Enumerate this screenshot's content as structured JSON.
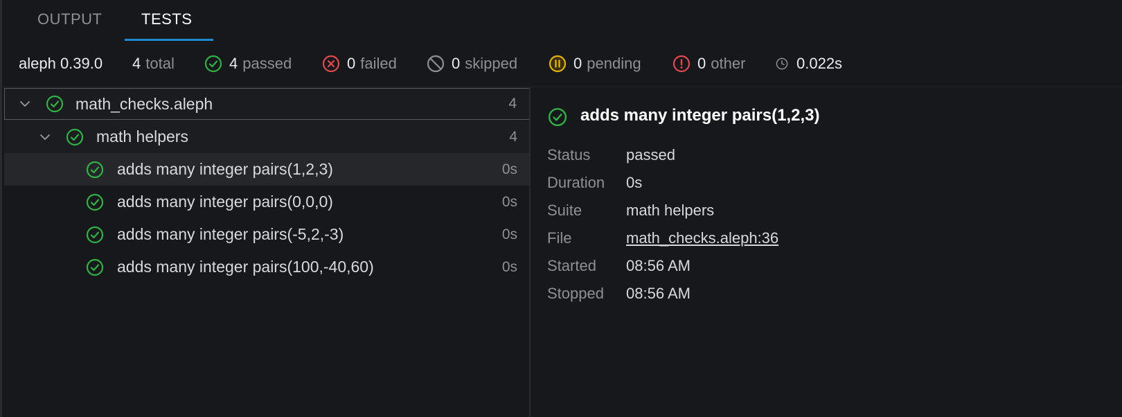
{
  "tabs": [
    {
      "label": "OUTPUT",
      "active": false
    },
    {
      "label": "TESTS",
      "active": true
    }
  ],
  "summary": {
    "runner": "aleph 0.39.0",
    "total": {
      "num": "4",
      "label": "total"
    },
    "passed": {
      "num": "4",
      "label": "passed",
      "icon": "check-circle-icon",
      "color": "#2fb344"
    },
    "failed": {
      "num": "0",
      "label": "failed",
      "icon": "x-circle-icon",
      "color": "#e5484d"
    },
    "skipped": {
      "num": "0",
      "label": "skipped",
      "icon": "skip-icon",
      "color": "#8e9096"
    },
    "pending": {
      "num": "0",
      "label": "pending",
      "icon": "pause-circle-icon",
      "color": "#e5b400"
    },
    "other": {
      "num": "0",
      "label": "other",
      "icon": "exclamation-circle-icon",
      "color": "#e5484d"
    },
    "duration": {
      "num": "0.022s",
      "icon": "clock-icon"
    }
  },
  "tree": {
    "file": {
      "label": "math_checks.aleph",
      "count": "4",
      "status": "passed"
    },
    "suite": {
      "label": "math helpers",
      "count": "4",
      "status": "passed"
    },
    "tests": [
      {
        "label": "adds many integer pairs(1,2,3)",
        "time": "0s",
        "selected": true
      },
      {
        "label": "adds many integer pairs(0,0,0)",
        "time": "0s",
        "selected": false
      },
      {
        "label": "adds many integer pairs(-5,2,-3)",
        "time": "0s",
        "selected": false
      },
      {
        "label": "adds many integer pairs(100,-40,60)",
        "time": "0s",
        "selected": false
      }
    ]
  },
  "detail": {
    "title": "adds many integer pairs(1,2,3)",
    "fields": [
      {
        "key": "Status",
        "value": "passed"
      },
      {
        "key": "Duration",
        "value": "0s"
      },
      {
        "key": "Suite",
        "value": "math helpers"
      },
      {
        "key": "File",
        "value": "math_checks.aleph:36",
        "link": true
      },
      {
        "key": "Started",
        "value": "08:56 AM"
      },
      {
        "key": "Stopped",
        "value": "08:56 AM"
      }
    ]
  },
  "colors": {
    "accent": "#1f8ad2",
    "pass": "#2fb344",
    "fail": "#e5484d",
    "pending": "#e5b400"
  }
}
